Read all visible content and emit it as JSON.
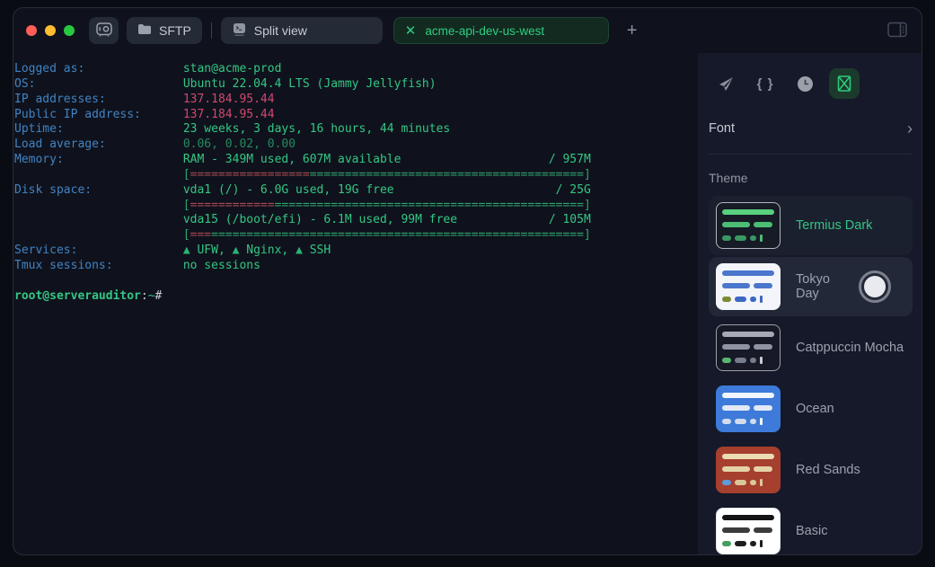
{
  "titlebar": {
    "traffic_lights": [
      "#ff5f57",
      "#febc2e",
      "#28c840"
    ],
    "sftp_label": "SFTP",
    "split_view_label": "Split view",
    "tab_label": "acme-api-dev-us-west",
    "tab_close": "✕",
    "new_tab_label": "+"
  },
  "terminal": {
    "lines": [
      {
        "segments": [
          {
            "t": "Logged as:",
            "c": "label"
          },
          {
            "t": "stan@acme-prod",
            "c": "green"
          }
        ]
      },
      {
        "segments": [
          {
            "t": "OS:",
            "c": "label"
          },
          {
            "t": "Ubuntu 22.04.4 LTS (Jammy Jellyfish)",
            "c": "green"
          }
        ]
      },
      {
        "segments": [
          {
            "t": "IP addresses:",
            "c": "label"
          },
          {
            "t": "137.184.95.44",
            "c": "pink"
          }
        ]
      },
      {
        "segments": [
          {
            "t": "Public IP address:",
            "c": "label"
          },
          {
            "t": "137.184.95.44",
            "c": "pink"
          }
        ]
      },
      {
        "segments": [
          {
            "t": "Uptime:",
            "c": "label"
          },
          {
            "t": "23 weeks, 3 days, 16 hours, 44 minutes",
            "c": "green"
          }
        ]
      },
      {
        "segments": [
          {
            "t": "Load average:",
            "c": "label"
          },
          {
            "t": "0.06, 0.02, 0.00",
            "c": "dim"
          }
        ]
      },
      {
        "segments": [
          {
            "t": "Memory:",
            "c": "label"
          },
          {
            "t": "RAM - 349M used, 607M available",
            "c": "green"
          },
          {
            "t": "/ 957M",
            "c": "green",
            "right": true
          }
        ]
      },
      {
        "segments": [
          {
            "t": "",
            "c": "label"
          },
          {
            "t": "[",
            "c": "bar-green"
          },
          {
            "t": "=================",
            "c": "bar-red"
          },
          {
            "t": "=======================================",
            "c": "bar-green"
          },
          {
            "t": "]",
            "c": "bar-green"
          }
        ]
      },
      {
        "segments": [
          {
            "t": "Disk space:",
            "c": "label"
          },
          {
            "t": "vda1 (/) - 6.0G used, 19G free",
            "c": "green"
          },
          {
            "t": "/ 25G",
            "c": "green",
            "right": true
          }
        ]
      },
      {
        "segments": [
          {
            "t": "",
            "c": "label"
          },
          {
            "t": "[",
            "c": "bar-green"
          },
          {
            "t": "============",
            "c": "bar-red"
          },
          {
            "t": "============================================",
            "c": "bar-green"
          },
          {
            "t": "]",
            "c": "bar-green"
          }
        ]
      },
      {
        "segments": [
          {
            "t": "",
            "c": "label"
          },
          {
            "t": "vda15 (/boot/efi) - 6.1M used, 99M free",
            "c": "green"
          },
          {
            "t": "/ 105M",
            "c": "green",
            "right": true
          }
        ]
      },
      {
        "segments": [
          {
            "t": "",
            "c": "label"
          },
          {
            "t": "[",
            "c": "bar-green"
          },
          {
            "t": "===",
            "c": "bar-red"
          },
          {
            "t": "=====================================================",
            "c": "bar-green"
          },
          {
            "t": "]",
            "c": "bar-green"
          }
        ]
      },
      {
        "segments": [
          {
            "t": "Services:",
            "c": "label"
          },
          {
            "t": "▲",
            "c": "tri"
          },
          {
            "t": " UFW, ",
            "c": "green"
          },
          {
            "t": "▲",
            "c": "tri"
          },
          {
            "t": " Nginx, ",
            "c": "green"
          },
          {
            "t": "▲",
            "c": "tri"
          },
          {
            "t": " SSH",
            "c": "green"
          }
        ]
      },
      {
        "segments": [
          {
            "t": "Tmux sessions:",
            "c": "label"
          },
          {
            "t": "no sessions",
            "c": "green"
          }
        ]
      },
      {
        "segments": []
      },
      {
        "segments": [
          {
            "t": "root@serverauditor",
            "c": "user"
          },
          {
            "t": ":",
            "c": "grey"
          },
          {
            "t": "~",
            "c": "green"
          },
          {
            "t": "#",
            "c": "grey"
          }
        ]
      }
    ]
  },
  "panel": {
    "toolbar_icons": [
      "send-icon",
      "snippets-icon",
      "history-icon",
      "appearance-icon"
    ],
    "active_icon": "appearance-icon",
    "font_label": "Font",
    "chevron": "›",
    "theme_label": "Theme",
    "accent_green": "#35c487",
    "themes": [
      {
        "name": "Termius Dark",
        "selected": true,
        "thumb": {
          "bg": "#161b26",
          "border": "#b0b5bf",
          "c1": "#58d07e",
          "c2": "#4cbd74",
          "c3": "#3b9763",
          "accent": "#3b9763",
          "cursor": "#4cbd74"
        }
      },
      {
        "name": "Tokyo Day",
        "hovered": true,
        "radio": true,
        "thumb": {
          "bg": "#f3f5fa",
          "border": "#f3f5fa",
          "c1": "#4a77cc",
          "c2": "#4a77cc",
          "c3": "#3d68c4",
          "accent": "#7c8a33",
          "cursor": "#3d68c4"
        }
      },
      {
        "name": "Catppuccin Mocha",
        "thumb": {
          "bg": "#181926",
          "border": "#9aa0ab",
          "c1": "#a6aab6",
          "c2": "#8f94a3",
          "c3": "#767c8c",
          "accent": "#57b56f",
          "cursor": "#c8ccd6"
        }
      },
      {
        "name": "Ocean",
        "thumb": {
          "bg": "#3d7ad9",
          "border": "#3d7ad9",
          "c1": "#f2f6fc",
          "c2": "#e2e9f5",
          "c3": "#d2dcef",
          "accent": "#d2dcef",
          "cursor": "#f2f6fc"
        }
      },
      {
        "name": "Red Sands",
        "thumb": {
          "bg": "#a63f2d",
          "border": "#a63f2d",
          "c1": "#ecdcb4",
          "c2": "#e4d2a8",
          "c3": "#dbc79c",
          "accent": "#5c9cdb",
          "cursor": "#dbc79c"
        }
      },
      {
        "name": "Basic",
        "thumb": {
          "bg": "#ffffff",
          "border": "#e2e5ea",
          "c1": "#141414",
          "c2": "#3c3c3c",
          "c3": "#1e1e1e",
          "accent": "#43a05f",
          "cursor": "#1e1e1e"
        }
      }
    ]
  }
}
